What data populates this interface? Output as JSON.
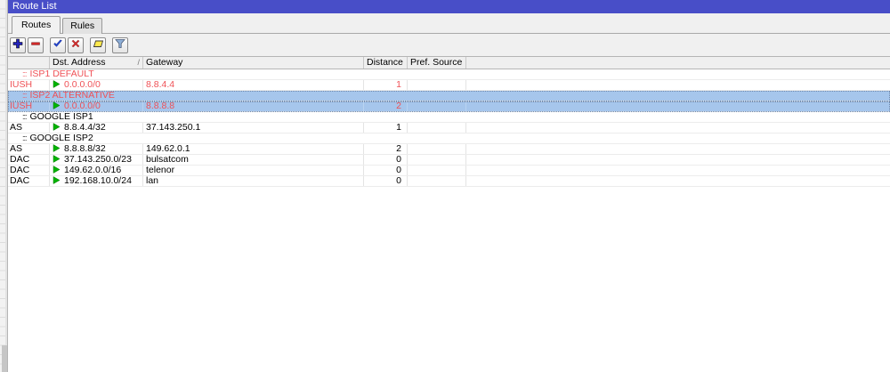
{
  "window": {
    "title": "Route List"
  },
  "tabs": [
    {
      "label": "Routes",
      "active": true
    },
    {
      "label": "Rules",
      "active": false
    }
  ],
  "toolbar": {
    "buttons": [
      {
        "name": "add",
        "icon": "plus-icon"
      },
      {
        "name": "remove",
        "icon": "minus-icon"
      },
      {
        "name": "enable",
        "icon": "check-icon"
      },
      {
        "name": "disable",
        "icon": "cross-icon"
      },
      {
        "name": "comment",
        "icon": "note-icon"
      },
      {
        "name": "filter",
        "icon": "funnel-icon"
      }
    ]
  },
  "table": {
    "columns": [
      "",
      "Dst. Address",
      "Gateway",
      "Distance",
      "Pref. Source",
      ""
    ],
    "sort_column": "Dst. Address",
    "sort_indicator": "/",
    "rows": [
      {
        "type": "comment",
        "color": "red",
        "selected": false,
        "text": "ISP1 DEFAULT"
      },
      {
        "type": "route",
        "color": "red",
        "selected": false,
        "flags": "IUSH",
        "dst_address": "0.0.0.0/0",
        "gateway": "8.8.4.4",
        "distance": "1",
        "pref_source": ""
      },
      {
        "type": "comment",
        "color": "red",
        "selected": true,
        "text": "ISP2 ALTERNATIVE"
      },
      {
        "type": "route",
        "color": "red",
        "selected": true,
        "flags": "IUSH",
        "dst_address": "0.0.0.0/0",
        "gateway": "8.8.8.8",
        "distance": "2",
        "pref_source": ""
      },
      {
        "type": "comment",
        "color": "black",
        "selected": false,
        "text": "GOOGLE ISP1"
      },
      {
        "type": "route",
        "color": "black",
        "selected": false,
        "flags": "AS",
        "dst_address": "8.8.4.4/32",
        "gateway": "37.143.250.1",
        "distance": "1",
        "pref_source": ""
      },
      {
        "type": "comment",
        "color": "black",
        "selected": false,
        "text": "GOOGLE ISP2"
      },
      {
        "type": "route",
        "color": "black",
        "selected": false,
        "flags": "AS",
        "dst_address": "8.8.8.8/32",
        "gateway": "149.62.0.1",
        "distance": "2",
        "pref_source": ""
      },
      {
        "type": "route",
        "color": "black",
        "selected": false,
        "flags": "DAC",
        "dst_address": "37.143.250.0/23",
        "gateway": "bulsatcom",
        "distance": "0",
        "pref_source": ""
      },
      {
        "type": "route",
        "color": "black",
        "selected": false,
        "flags": "DAC",
        "dst_address": "149.62.0.0/16",
        "gateway": "telenor",
        "distance": "0",
        "pref_source": ""
      },
      {
        "type": "route",
        "color": "black",
        "selected": false,
        "flags": "DAC",
        "dst_address": "192.168.10.0/24",
        "gateway": "lan",
        "distance": "0",
        "pref_source": ""
      }
    ],
    "comment_icon": ":::"
  },
  "colors": {
    "titlebar": "#484ec8",
    "selection": "#a6c6ec",
    "inactive_red": "#ef5156",
    "route_arrow_green": "#00b400",
    "window_bg": "#f0f0f0"
  }
}
